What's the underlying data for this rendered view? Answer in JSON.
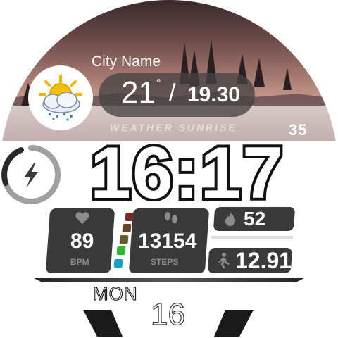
{
  "weather": {
    "city": "City Name",
    "temperature": "21",
    "temp_unit": "°",
    "separator": "/",
    "sunrise": "19.30",
    "label": "WEATHER  SUNRISE",
    "icon": "partly-cloudy-rain-icon"
  },
  "time": {
    "display": "16:17",
    "seconds": "35"
  },
  "battery": {
    "icon": "lightning-bolt-icon",
    "ring_color": "#9a9a9a"
  },
  "stats": {
    "heart_rate": {
      "value": "89",
      "unit": "BPM",
      "icon": "heart-icon"
    },
    "steps": {
      "value": "13154",
      "unit": "STEPS",
      "icon": "footprints-icon"
    },
    "calories": {
      "value": "52",
      "icon": "flame-icon"
    },
    "distance": {
      "value": "12.91",
      "icon": "walking-person-icon"
    },
    "progress_dot_colors": [
      "#7a2a2a",
      "#6a4426",
      "#6a5a2a",
      "#2fb52f",
      "#1aa0c0"
    ]
  },
  "date": {
    "weekday": "MON",
    "day": "16"
  }
}
